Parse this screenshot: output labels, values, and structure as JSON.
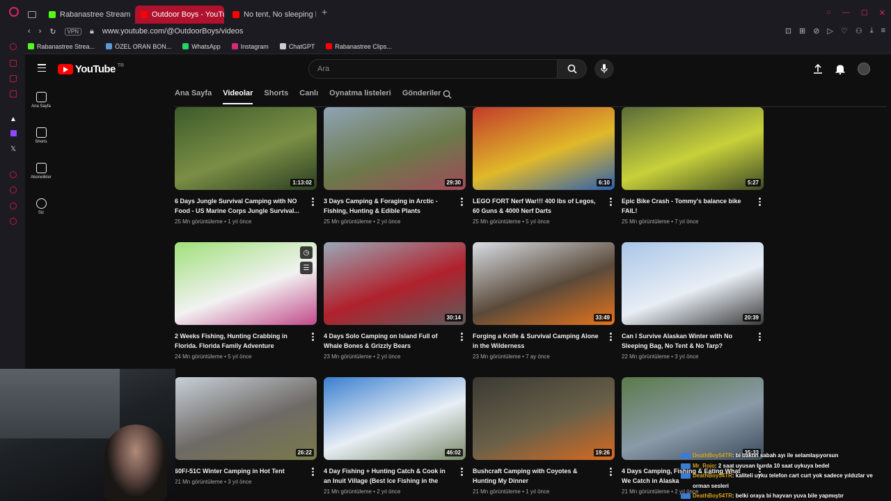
{
  "browser": {
    "tabs": [
      {
        "label": "Rabanastree Stream - Wa",
        "active": false,
        "favicon_color": "#53fc18"
      },
      {
        "label": "Outdoor Boys - YouTube",
        "active": true,
        "favicon_color": "#ff0000"
      },
      {
        "label": "No tent, No sleeping bag",
        "active": false,
        "favicon_color": "#ff0000"
      }
    ],
    "vpn_label": "VPN",
    "url": "www.youtube.com/@OutdoorBoys/videos",
    "bookmarks": [
      {
        "label": "Rabanastree Strea...",
        "color": "#53fc18"
      },
      {
        "label": "ÖZEL ORAN BON...",
        "color": "#5a9bd5"
      },
      {
        "label": "WhatsApp",
        "color": "#25d366"
      },
      {
        "label": "Instagram",
        "color": "#d62976"
      },
      {
        "label": "ChatGPT",
        "color": "#cccccc"
      },
      {
        "label": "Rabanastree Clips...",
        "color": "#ff0000"
      }
    ],
    "accent_color": "#b0112d"
  },
  "youtube": {
    "logo_text": "YouTube",
    "country_code": "TR",
    "search_placeholder": "Ara",
    "guide": [
      {
        "label": "Ana Sayfa",
        "icon": "home-icon"
      },
      {
        "label": "Shorts",
        "icon": "shorts-icon"
      },
      {
        "label": "Abonelikler",
        "icon": "subscriptions-icon"
      },
      {
        "label": "Siz",
        "icon": "you-icon"
      }
    ],
    "channel_tabs": [
      "Ana Sayfa",
      "Videolar",
      "Shorts",
      "Canlı",
      "Oynatma listeleri",
      "Gönderiler"
    ],
    "active_tab": "Videolar",
    "videos": [
      {
        "title": "6 Days Jungle Survival Camping with NO Food - US Marine Corps Jungle Survival...",
        "views": "25 Mn görüntüleme",
        "age": "1 yıl önce",
        "duration": "1:13:02",
        "colors": [
          "#3d5a2a",
          "#7a8f45",
          "#2c3e22"
        ]
      },
      {
        "title": "3 Days Camping & Foraging in Arctic - Fishing, Hunting & Edible Plants",
        "views": "25 Mn görüntüleme",
        "age": "2 yıl önce",
        "duration": "29:30",
        "colors": [
          "#8fa3b5",
          "#6b7a4a",
          "#a04a5a"
        ]
      },
      {
        "title": "LEGO FORT Nerf War!!! 400 lbs of Legos, 60 Guns & 4000 Nerf Darts",
        "views": "25 Mn görüntüleme",
        "age": "5 yıl önce",
        "duration": "6:10",
        "colors": [
          "#c23b2b",
          "#e0b92a",
          "#2d5fb0"
        ]
      },
      {
        "title": "Epic Bike Crash - Tommy's balance bike FAIL!",
        "views": "25 Mn görüntüleme",
        "age": "7 yıl önce",
        "duration": "5:27",
        "colors": [
          "#5a6b3a",
          "#c8d13a",
          "#3e4a28"
        ]
      },
      {
        "title": "2 Weeks Fishing, Hunting Crabbing in Florida. Florida Family Adventure",
        "views": "24 Mn görüntüleme",
        "age": "5 yıl önce",
        "duration": "",
        "colors": [
          "#9fe07a",
          "#f2f2f2",
          "#c04a8a"
        ]
      },
      {
        "title": "4 Days Solo Camping on Island Full of Whale Bones & Grizzly Bears",
        "views": "23 Mn görüntüleme",
        "age": "2 yıl önce",
        "duration": "30:14",
        "colors": [
          "#9aa8b8",
          "#b0212c",
          "#5c5c5c"
        ]
      },
      {
        "title": "Forging a Knife & Survival Camping Alone in the Wilderness",
        "views": "23 Mn görüntüleme",
        "age": "7 ay önce",
        "duration": "33:49",
        "colors": [
          "#d8dde4",
          "#5a4a3a",
          "#e8741c"
        ]
      },
      {
        "title": "Can I Survive Alaskan Winter with No Sleeping Bag, No Tent & No Tarp?",
        "views": "22 Mn görüntüleme",
        "age": "3 yıl önce",
        "duration": "20:39",
        "colors": [
          "#a9c6e8",
          "#e8eef5",
          "#3a3a3a"
        ]
      },
      {
        "title": "60F/-51C Winter Camping in Hot Tent",
        "views": "21 Mn görüntüleme",
        "age": "3 yıl önce",
        "duration": "26:22",
        "colors": [
          "#c8d0d8",
          "#6e6a66",
          "#7a7a4a"
        ]
      },
      {
        "title": "4 Day Fishing + Hunting Catch & Cook in an Inuit Village (Best Ice Fishing in the World)",
        "views": "21 Mn görüntüleme",
        "age": "2 yıl önce",
        "duration": "46:02",
        "colors": [
          "#3a7fd0",
          "#e8eef5",
          "#7a8a6a"
        ]
      },
      {
        "title": "Bushcraft Camping with Coyotes & Hunting My Dinner",
        "views": "21 Mn görüntüleme",
        "age": "1 yıl önce",
        "duration": "19:26",
        "colors": [
          "#3a3a34",
          "#6a6048",
          "#d86a20"
        ]
      },
      {
        "title": "4 Days Camping, Fishing & Eating What We Catch in Alaska",
        "views": "21 Mn görüntüleme",
        "age": "2 yıl önce",
        "duration": "35:33",
        "colors": [
          "#5a7a4a",
          "#8a9aa8",
          "#3a4a5a"
        ]
      }
    ]
  },
  "chat": [
    {
      "user": "DeathBoy54TR",
      "message": ": bi baktın sabah ayı ile selamlaşıyorsun"
    },
    {
      "user": "Mr_Rojo",
      "message": ": 2 saat uyusan burda 10 saat uykuya bedel"
    },
    {
      "user": "DeathBoy54TR",
      "message": ": kaliteli uyku telefon cart curt yok sadece yıldızlar ve orman sesleri"
    },
    {
      "user": "DeathBoy54TR",
      "message": ": belki oraya bi hayvan yuva bile yapmıştır"
    }
  ]
}
